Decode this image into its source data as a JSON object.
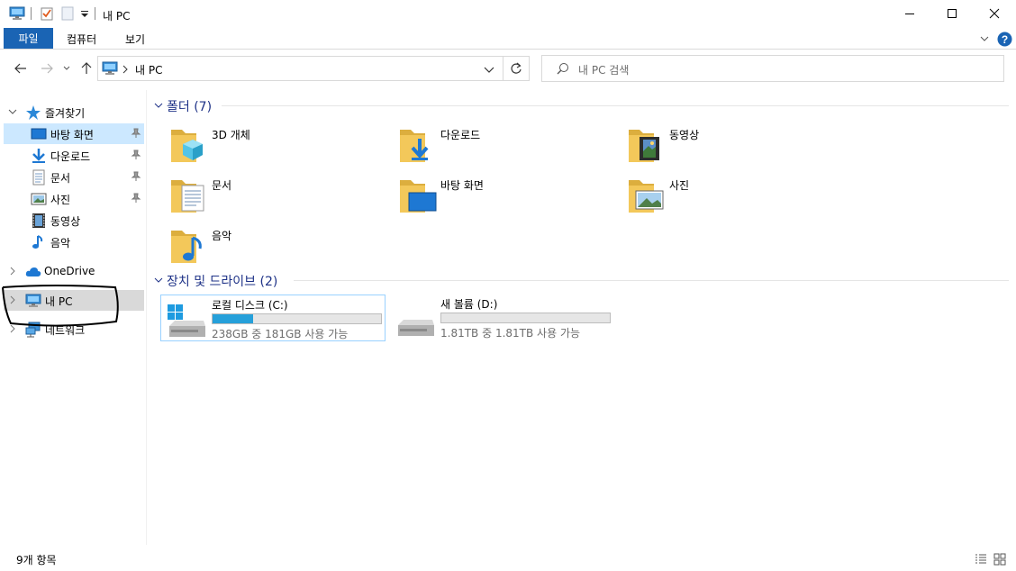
{
  "window": {
    "title": "내 PC",
    "minimize_glyph": "─",
    "maximize_glyph": "☐",
    "close_glyph": "✕"
  },
  "ribbon": {
    "tabs": [
      {
        "label": "파일",
        "active": true
      },
      {
        "label": "컴퓨터"
      },
      {
        "label": "보기"
      }
    ],
    "help_glyph": "?"
  },
  "address_bar": {
    "path": "내 PC",
    "search_placeholder": "내 PC 검색"
  },
  "navigation": {
    "quick_access": {
      "label": "즐겨찾기",
      "items": [
        {
          "label": "바탕 화면",
          "icon": "desktop-icon",
          "pinned": true,
          "selected": true
        },
        {
          "label": "다운로드",
          "icon": "download-icon",
          "pinned": true
        },
        {
          "label": "문서",
          "icon": "document-icon",
          "pinned": true
        },
        {
          "label": "사진",
          "icon": "pictures-icon",
          "pinned": true
        },
        {
          "label": "동영상",
          "icon": "video-icon"
        },
        {
          "label": "음악",
          "icon": "music-icon"
        }
      ]
    },
    "onedrive": {
      "label": "OneDrive"
    },
    "this_pc": {
      "label": "내 PC",
      "selected": true
    },
    "network": {
      "label": "네트워크"
    }
  },
  "content": {
    "folders_group": {
      "title": "폴더 (7)",
      "items": [
        {
          "label": "3D 개체",
          "icon": "3d-objects-icon"
        },
        {
          "label": "다운로드",
          "icon": "download-folder-icon"
        },
        {
          "label": "동영상",
          "icon": "videos-folder-icon"
        },
        {
          "label": "문서",
          "icon": "documents-folder-icon"
        },
        {
          "label": "바탕 화면",
          "icon": "desktop-folder-icon"
        },
        {
          "label": "사진",
          "icon": "pictures-folder-icon"
        },
        {
          "label": "음악",
          "icon": "music-folder-icon"
        }
      ]
    },
    "drives_group": {
      "title": "장치 및 드라이브 (2)",
      "items": [
        {
          "name": "로컬 디스크 (C:)",
          "status": "238GB 중 181GB 사용 가능",
          "used_fraction": 0.24,
          "selected": true
        },
        {
          "name": "새 볼륨 (D:)",
          "status": "1.81TB 중 1.81TB 사용 가능",
          "used_fraction": 0.0
        }
      ]
    }
  },
  "status_bar": {
    "item_count": "9개 항목"
  },
  "colors": {
    "accent": "#1a64b4",
    "group_title": "#1e3287",
    "selection_light": "#cce8ff",
    "selection_gray": "#d9d9d9",
    "progress": "#26a0da",
    "folder": "#f3c85a"
  }
}
